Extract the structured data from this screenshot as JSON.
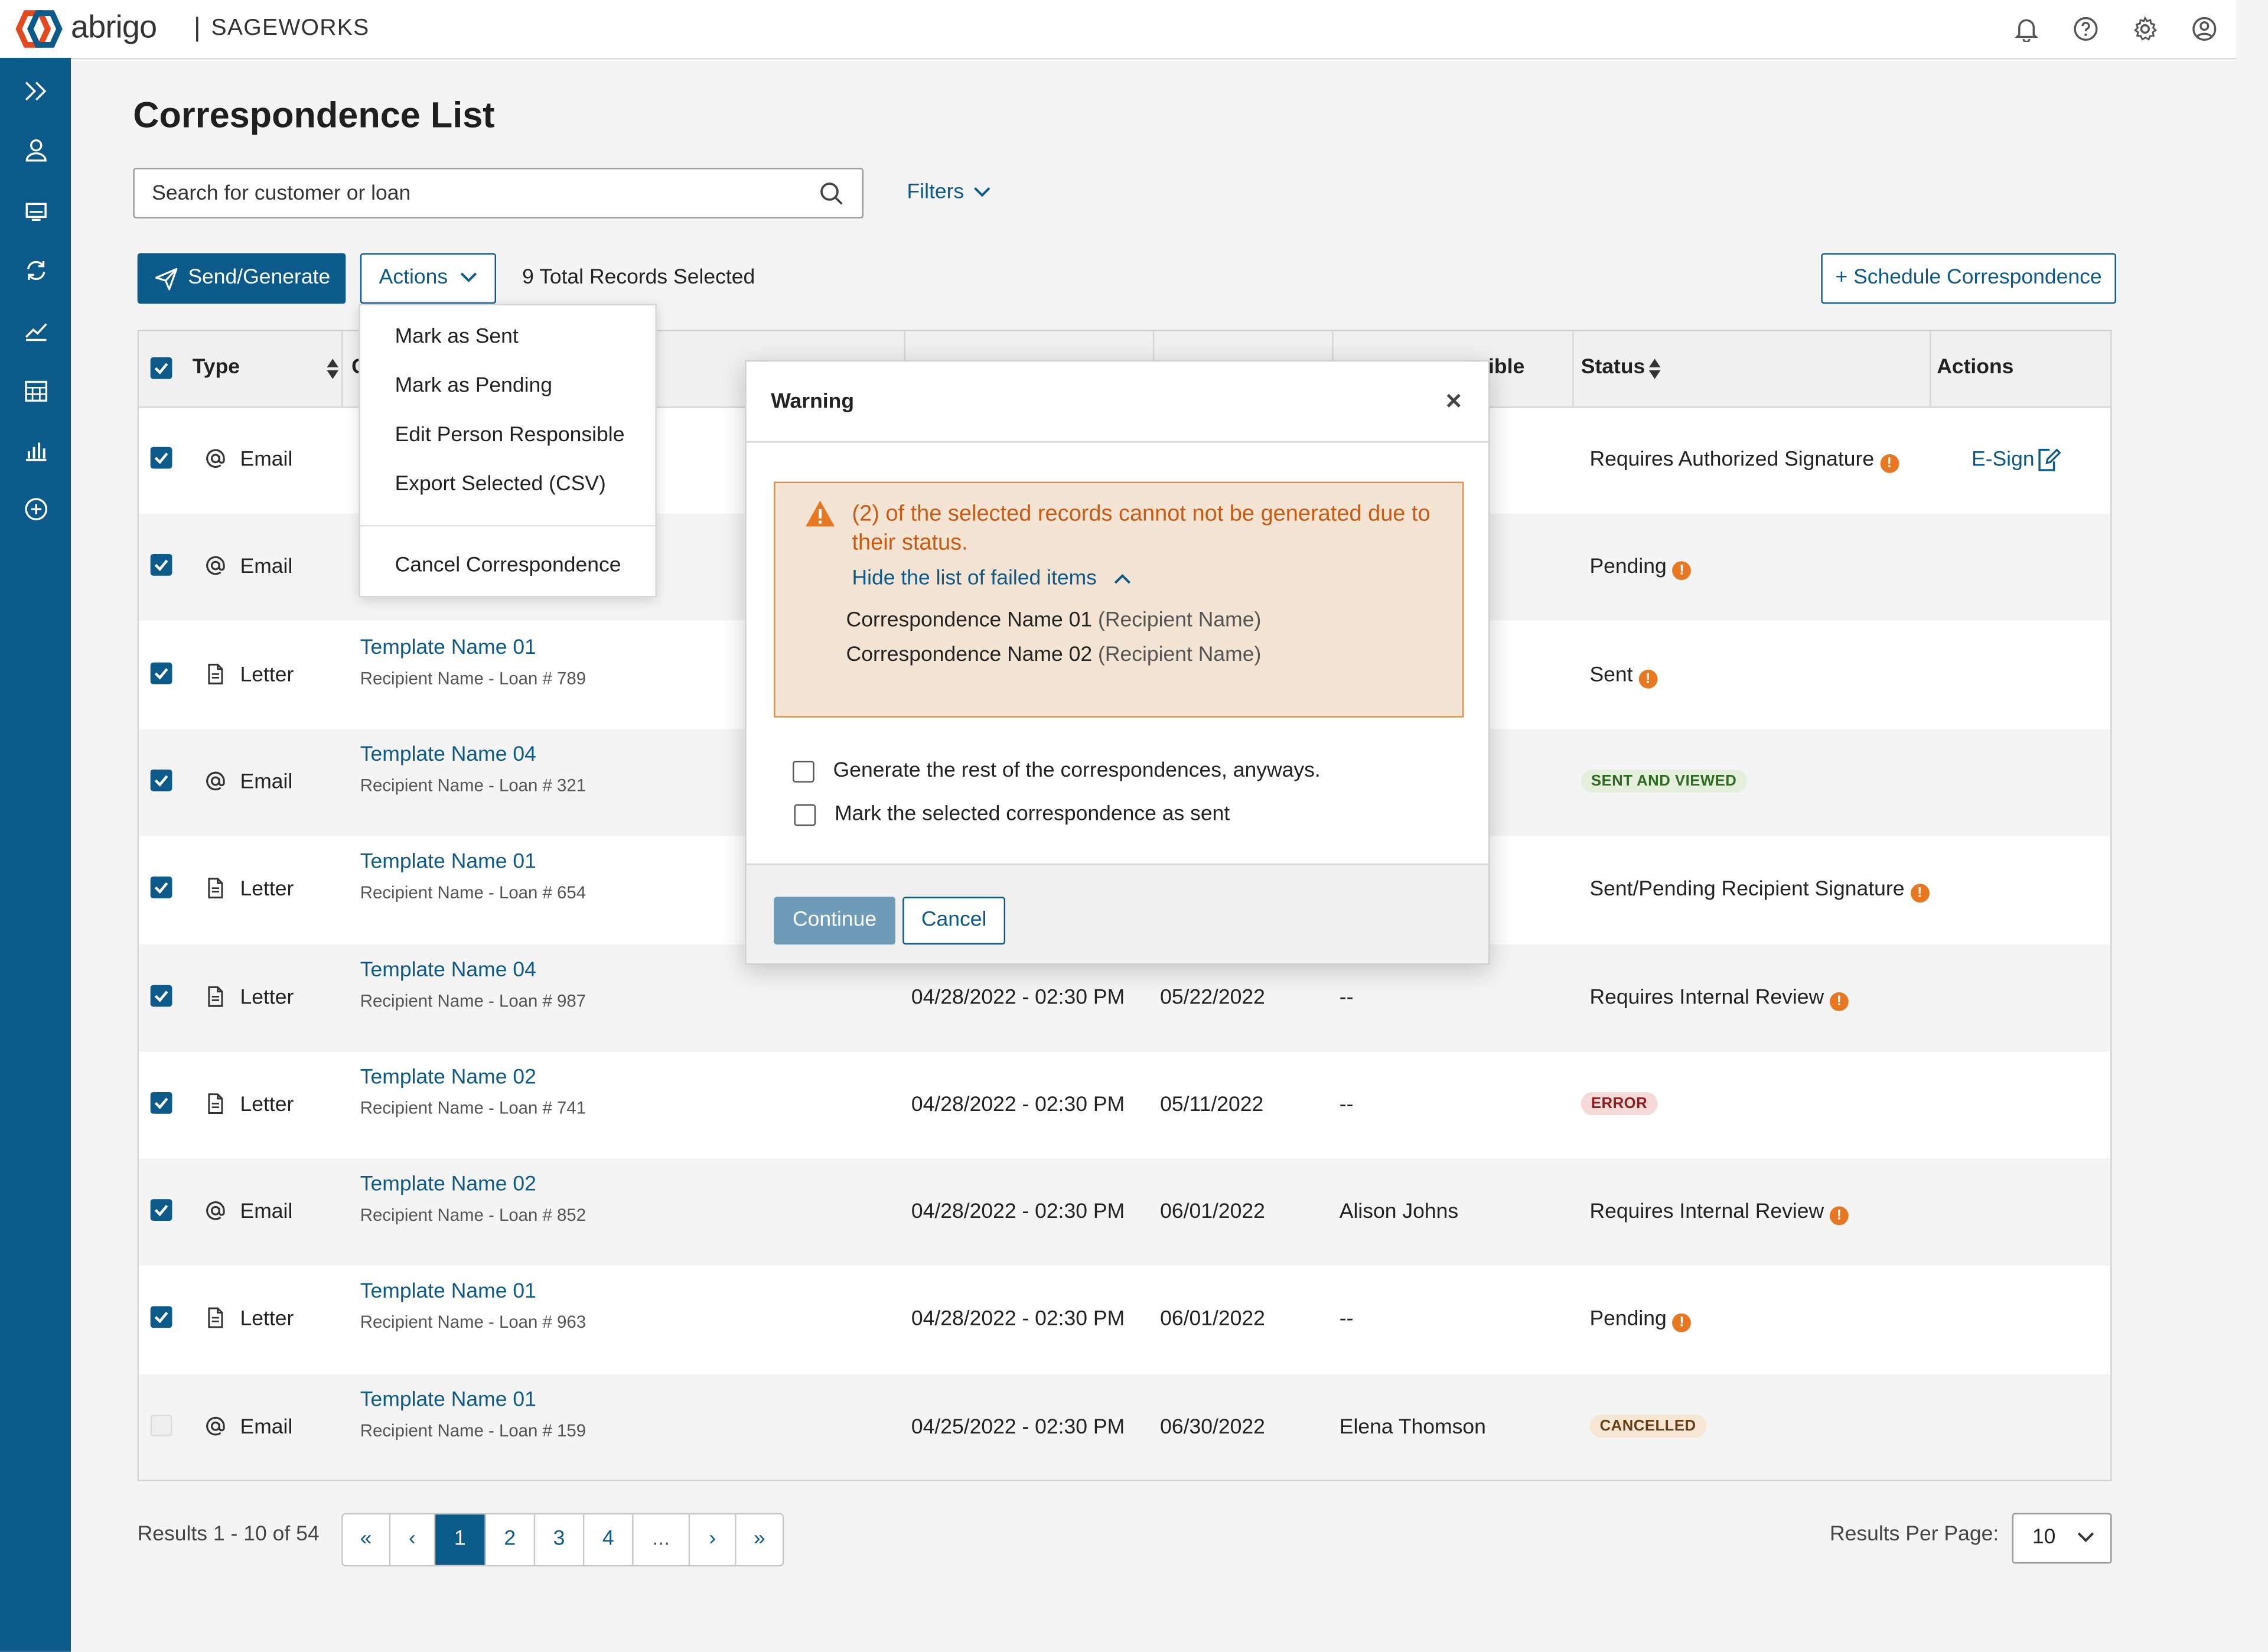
{
  "app": {
    "brand": "abrigo",
    "separator": "|",
    "product": "SAGEWORKS"
  },
  "top_icons": [
    "bell-icon",
    "help-icon",
    "gear-icon",
    "user-circle-icon"
  ],
  "sidebar_icons": [
    "expand-icon",
    "person-icon",
    "monitor-icon",
    "sync-icon",
    "trend-icon",
    "calendar-icon",
    "bar-chart-icon",
    "plus-circle-icon"
  ],
  "page": {
    "title": "Correspondence List"
  },
  "search": {
    "placeholder": "Search for customer or loan"
  },
  "filters": {
    "label": "Filters"
  },
  "toolbar": {
    "send_label": "Send/Generate",
    "actions_label": "Actions",
    "total_selected": "9 Total Records Selected",
    "schedule_label": "+ Schedule Correspondence"
  },
  "table": {
    "headers": {
      "type": "Type",
      "c2": "C",
      "c6": "ible",
      "status": "Status",
      "actions": "Actions"
    },
    "rows": [
      {
        "checked": true,
        "type": "Email",
        "icon": "at-icon",
        "template": "",
        "recipient": "",
        "date": "",
        "due": "",
        "person": "",
        "status": "Requires Authorized Signature",
        "status_kind": "warn",
        "action": "E-Sign"
      },
      {
        "checked": true,
        "type": "Email",
        "icon": "at-icon",
        "template": "",
        "recipient": "",
        "date": "",
        "due": "",
        "person": "",
        "status": "Pending",
        "status_kind": "warn",
        "action": ""
      },
      {
        "checked": true,
        "type": "Letter",
        "icon": "document-icon",
        "template": "Template Name 01",
        "recipient": "Recipient Name - Loan # 789",
        "date": "",
        "due": "",
        "person": "",
        "status": "Sent",
        "status_kind": "warn",
        "action": ""
      },
      {
        "checked": true,
        "type": "Email",
        "icon": "at-icon",
        "template": "Template Name 04",
        "recipient": "Recipient Name - Loan # 321",
        "date": "",
        "due": "",
        "person": "",
        "status": "SENT AND VIEWED",
        "status_kind": "pill-green",
        "action": ""
      },
      {
        "checked": true,
        "type": "Letter",
        "icon": "document-icon",
        "template": "Template Name 01",
        "recipient": "Recipient Name - Loan # 654",
        "date": "",
        "due": "",
        "person": "",
        "status": "Sent/Pending Recipient Signature",
        "status_kind": "warn",
        "action": ""
      },
      {
        "checked": true,
        "type": "Letter",
        "icon": "document-icon",
        "template": "Template Name 04",
        "recipient": "Recipient Name - Loan # 987",
        "date": "04/28/2022 - 02:30 PM",
        "due": "05/22/2022",
        "person": "--",
        "status": "Requires Internal Review",
        "status_kind": "warn",
        "action": ""
      },
      {
        "checked": true,
        "type": "Letter",
        "icon": "document-icon",
        "template": "Template Name 02",
        "recipient": "Recipient Name - Loan # 741",
        "date": "04/28/2022 - 02:30 PM",
        "due": "05/11/2022",
        "person": "--",
        "status": "ERROR",
        "status_kind": "pill-red",
        "action": ""
      },
      {
        "checked": true,
        "type": "Email",
        "icon": "at-icon",
        "template": "Template Name 02",
        "recipient": "Recipient Name - Loan # 852",
        "date": "04/28/2022 - 02:30 PM",
        "due": "06/01/2022",
        "person": "Alison Johns",
        "status": "Requires Internal Review",
        "status_kind": "warn",
        "action": ""
      },
      {
        "checked": true,
        "type": "Letter",
        "icon": "document-icon",
        "template": "Template Name 01",
        "recipient": "Recipient Name - Loan # 963",
        "date": "04/28/2022 - 02:30 PM",
        "due": "06/01/2022",
        "person": "--",
        "status": "Pending",
        "status_kind": "warn",
        "action": ""
      },
      {
        "checked": false,
        "type": "Email",
        "icon": "at-icon",
        "template": "Template Name 01",
        "recipient": "Recipient Name - Loan # 159",
        "date": "04/25/2022 - 02:30 PM",
        "due": "06/30/2022",
        "person": "Elena Thomson",
        "status": "CANCELLED",
        "status_kind": "pill-orange",
        "action": ""
      }
    ]
  },
  "pagination": {
    "results": "Results 1 - 10 of 54",
    "buttons": [
      "«",
      "‹",
      "1",
      "2",
      "3",
      "4",
      "...",
      "›",
      "»"
    ],
    "active": "1",
    "per_page_label": "Results Per Page:",
    "per_page_value": "10"
  },
  "actions_menu": {
    "items": [
      "Mark as Sent",
      "Mark as Pending",
      "Edit Person Responsible",
      "Export Selected (CSV)"
    ],
    "cancel": "Cancel Correspondence"
  },
  "modal": {
    "title": "Warning",
    "message": "(2) of the selected records cannot not be generated due to their status.",
    "toggle": "Hide the list of failed items",
    "failed": [
      {
        "name": "Correspondence Name 01",
        "recipient": "(Recipient Name)"
      },
      {
        "name": "Correspondence Name 02",
        "recipient": "(Recipient Name)"
      }
    ],
    "option1": "Generate the rest of the correspondences, anyways.",
    "option2": "Mark the selected correspondence as sent",
    "continue": "Continue",
    "cancel": "Cancel"
  },
  "colors": {
    "primary": "#0b5a8a",
    "warning": "#e87722",
    "alert_bg": "#f3e4d3",
    "alert_text": "#cc5a12"
  }
}
